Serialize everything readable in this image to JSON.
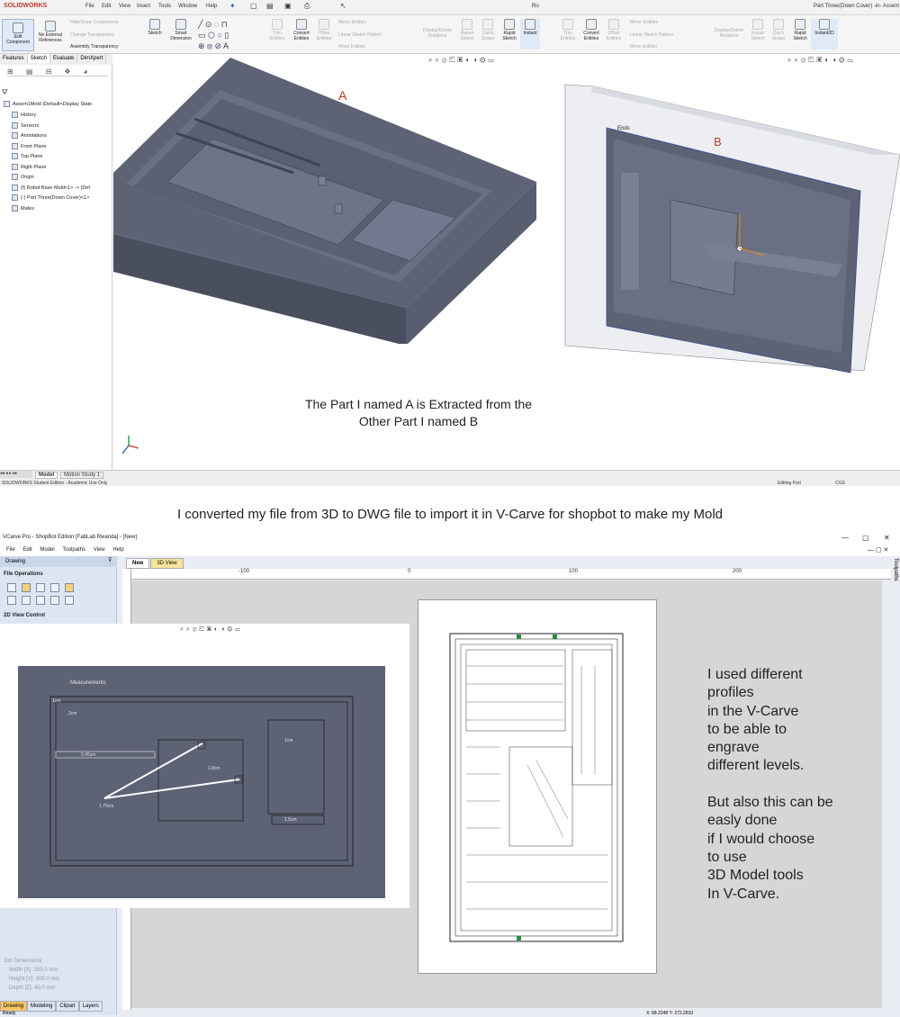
{
  "solidworks": {
    "logo": "SOLIDWORKS",
    "menu": [
      "File",
      "Edit",
      "View",
      "Insert",
      "Tools",
      "Window",
      "Help"
    ],
    "window_title_left": "Ro",
    "window_title_right": "Part Three(Down Cover) -in- Assem",
    "ribbon": {
      "edit_component": "Edit Component",
      "no_external_references": "No External References",
      "hide_show_components": "Hide/Show Components",
      "change_transparency": "Change Transparency",
      "assembly_transparency": "Assembly Transparency",
      "sketch": "Sketch",
      "smart_dimension": "Smart Dimension",
      "trim_entities": "Trim Entities",
      "convert_entities": "Convert Entities",
      "offset_entities": "Offset Entities",
      "mirror_entities": "Mirror Entities",
      "linear_sketch_pattern": "Linear Sketch Pattern",
      "move_entities": "Move Entities",
      "display_delete_relations": "Display/Delete Relations",
      "repair_sketch": "Repair Sketch",
      "quick_snaps": "Quick Snaps",
      "rapid_sketch": "Rapid Sketch",
      "instant2d_left": "Instant",
      "instant2d_right": "Instant2D"
    },
    "tabs": [
      "Features",
      "Sketch",
      "Evaluate",
      "DimXpert"
    ],
    "tree": [
      "Assem1Mold (Default<Display State",
      "History",
      "Sensors",
      "Annotations",
      "Front Plane",
      "Top Plane",
      "Right Plane",
      "Origin",
      "(f) Robot Base Mold<1> -> (Def",
      "(-) Part Three(Down Cover)<1>",
      "Mates"
    ],
    "bottom_tabs": [
      "Model",
      "Motion Study 1"
    ],
    "status_left": "SOLIDWORKS Student Edition - Academic Use Only",
    "status_editing": "Editing Part",
    "status_units": "CGS",
    "label_a": "A",
    "label_b": "B",
    "model_b_tag": "Ends",
    "caption": "The Part I named A is Extracted from the\nOther Part I named B"
  },
  "mid_caption": "I converted my file from  3D to DWG file to import it in V-Carve for shopbot to make my Mold",
  "vcarve": {
    "title": "VCarve Pro - ShopBot Edition [FabLab Rwanda] - [New]",
    "menu": [
      "File",
      "Edit",
      "Model",
      "Toolpaths",
      "View",
      "Help"
    ],
    "panel_title": "Drawing",
    "file_operations": "File Operations",
    "view_control": "2D View Control",
    "doc_tabs": [
      "New",
      "3D View"
    ],
    "ruler_ticks": [
      "-100",
      "0",
      "100",
      "200"
    ],
    "side_tab": "Toolpaths",
    "job_dimensions": {
      "heading": "Job Dimensions",
      "width": "Width  [X]: 155.0 mm",
      "height": "Height [Y]: 305.0 mm",
      "depth": "Depth  [Z]: 40.0 mm"
    },
    "bottom_tabs": [
      "Drawing",
      "Modeling",
      "Clipart",
      "Layers"
    ],
    "status_left": "Ready",
    "status_right": "X: 68.2248 Y: 272.2810",
    "measurements": {
      "title": "Measurements",
      "m1": "1cm",
      "m2": "2cm",
      "m3": "0.45cm",
      "m4": "1.8cm",
      "m5": "1cm",
      "m6": "1.75cm",
      "m7": "1.5cm"
    }
  },
  "note": "I used different\n profiles\nin the V-Carve\nto be able to\nengrave\ndifferent levels.\n\nBut also this can be\neasly done\nif I would choose\nto use\n3D Model tools\nIn V-Carve.",
  "colors": {
    "model_gray": "#5d6275",
    "label_red": "#c0392b",
    "vcarve_panel": "#dce6f3",
    "drawing_tab": "#f7c663"
  }
}
